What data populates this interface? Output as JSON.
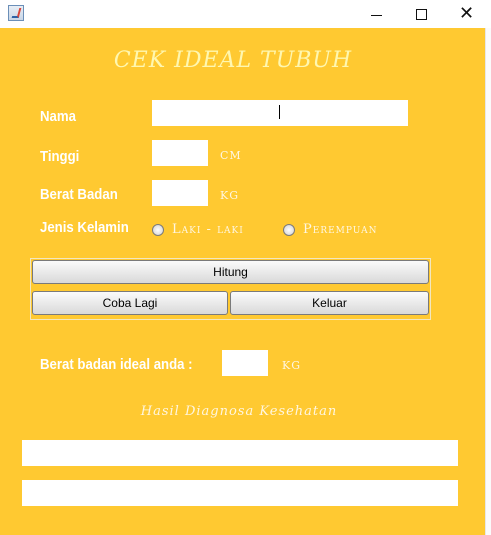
{
  "window": {
    "minimize_symbol": "—",
    "close_symbol": "✕"
  },
  "form": {
    "title": "CEK IDEAL TUBUH",
    "nama_label": "Nama",
    "nama_value": "",
    "tinggi_label": "Tinggi",
    "tinggi_value": "",
    "tinggi_unit": "CM",
    "berat_label": "Berat Badan",
    "berat_value": "",
    "berat_unit": "KG",
    "gender_label": "Jenis Kelamin",
    "gender_options": [
      "Laki - laki",
      "Perempuan"
    ],
    "gender_selected": null
  },
  "buttons": {
    "hitung": "Hitung",
    "coba_lagi": "Coba Lagi",
    "keluar": "Keluar"
  },
  "result": {
    "label": "Berat badan ideal anda :",
    "value": "",
    "unit": "KG",
    "diagnosis_title": "Hasil Diagnosa Kesehatan",
    "diagnosis_line1": "",
    "diagnosis_line2": ""
  },
  "colors": {
    "panel_background": "#ffc931",
    "label_text": "#ffffff",
    "title_text": "#fff7b0"
  }
}
